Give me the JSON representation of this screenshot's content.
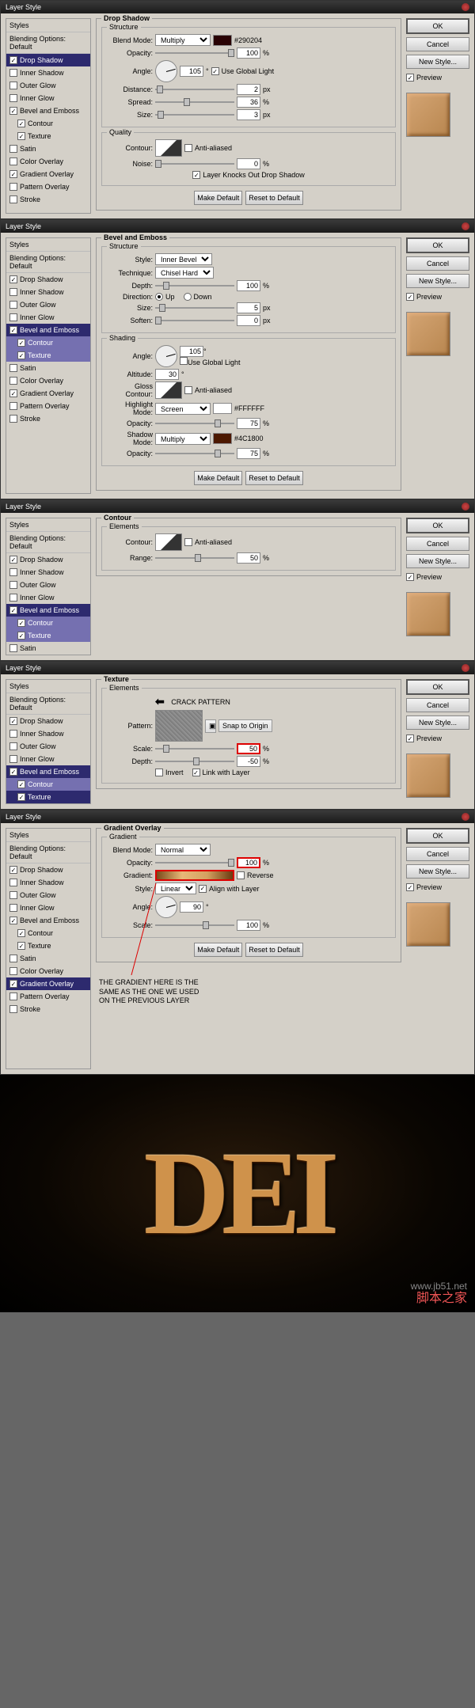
{
  "title": "Layer Style",
  "side": {
    "h1": "Styles",
    "h2": "Blending Options: Default",
    "items": [
      "Drop Shadow",
      "Inner Shadow",
      "Outer Glow",
      "Inner Glow",
      "Bevel and Emboss",
      "Contour",
      "Texture",
      "Satin",
      "Color Overlay",
      "Gradient Overlay",
      "Pattern Overlay",
      "Stroke"
    ]
  },
  "btns": {
    "ok": "OK",
    "cancel": "Cancel",
    "new": "New Style...",
    "prev": "Preview",
    "mk": "Make Default",
    "rst": "Reset to Default",
    "snap": "Snap to Origin"
  },
  "p1": {
    "title": "Drop Shadow",
    "struct": "Structure",
    "qual": "Quality",
    "blend": "Blend Mode:",
    "opac": "Opacity:",
    "angle": "Angle:",
    "dist": "Distance:",
    "spread": "Spread:",
    "size": "Size:",
    "cont": "Contour:",
    "noise": "Noise:",
    "aa": "Anti-aliased",
    "ugl": "Use Global Light",
    "knock": "Layer Knocks Out Drop Shadow",
    "mode": "Multiply",
    "color": "#290204",
    "v_op": "100",
    "v_ang": "105",
    "v_dist": "2",
    "v_spr": "36",
    "v_sz": "3",
    "v_noise": "0",
    "px": "px",
    "deg": "°",
    "pct": "%"
  },
  "p2": {
    "title": "Bevel and Emboss",
    "struct": "Structure",
    "shad": "Shading",
    "style": "Style:",
    "tech": "Technique:",
    "depth": "Depth:",
    "dir": "Direction:",
    "up": "Up",
    "down": "Down",
    "size": "Size:",
    "soft": "Soften:",
    "angle": "Angle:",
    "alt": "Altitude:",
    "gloss": "Gloss Contour:",
    "hlm": "Highlight Mode:",
    "shm": "Shadow Mode:",
    "opac": "Opacity:",
    "ugl": "Use Global Light",
    "aa": "Anti-aliased",
    "v_style": "Inner Bevel",
    "v_tech": "Chisel Hard",
    "v_depth": "100",
    "v_sz": "5",
    "v_soft": "0",
    "v_ang": "105",
    "v_alt": "30",
    "v_hlm": "Screen",
    "v_hlc": "#FFFFFF",
    "v_hlo": "75",
    "v_shm": "Multiply",
    "v_shc": "#4C1800",
    "v_sho": "75"
  },
  "p3": {
    "title": "Contour",
    "elem": "Elements",
    "cont": "Contour:",
    "range": "Range:",
    "aa": "Anti-aliased",
    "v_range": "50"
  },
  "p4": {
    "title": "Texture",
    "elem": "Elements",
    "pat": "Pattern:",
    "scale": "Scale:",
    "depth": "Depth:",
    "inv": "Invert",
    "link": "Link with Layer",
    "crack": "CRACK PATTERN",
    "v_scale": "50",
    "v_depth": "-50"
  },
  "p5": {
    "title": "Gradient Overlay",
    "grad": "Gradient",
    "blend": "Blend Mode:",
    "opac": "Opacity:",
    "gradient": "Gradient:",
    "style": "Style:",
    "angle": "Angle:",
    "scale": "Scale:",
    "mode": "Normal",
    "rev": "Reverse",
    "align": "Align with Layer",
    "v_op": "100",
    "v_style": "Linear",
    "v_ang": "90",
    "v_scale": "100",
    "note1": "THE GRADIENT HERE IS THE",
    "note2": "SAME AS THE ONE WE USED",
    "note3": "ON THE PREVIOUS LAYER"
  },
  "watermark": "脚本之家"
}
